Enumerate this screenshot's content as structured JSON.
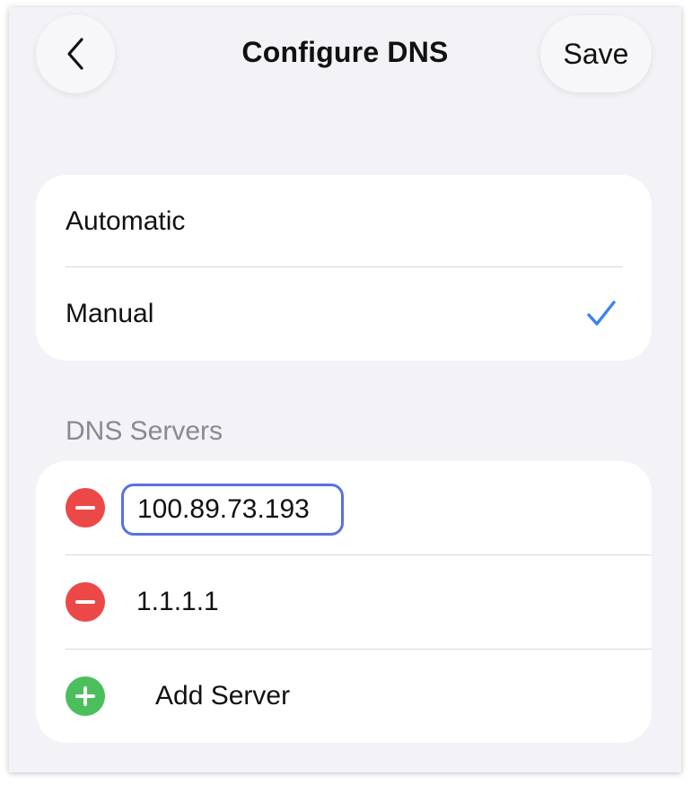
{
  "header": {
    "title": "Configure DNS",
    "back_icon": "chevron-left-icon",
    "save_label": "Save"
  },
  "mode": {
    "options": [
      {
        "label": "Automatic",
        "selected": false
      },
      {
        "label": "Manual",
        "selected": true
      }
    ],
    "check_icon": "checkmark-icon",
    "accent_color": "#3a82f7"
  },
  "dns": {
    "section_title": "DNS Servers",
    "servers": [
      {
        "value": "100.89.73.193",
        "editing": true
      },
      {
        "value": "1.1.1.1",
        "editing": false
      }
    ],
    "add_label": "Add Server",
    "remove_color": "#ec4848",
    "add_color": "#4bbf5c",
    "focus_color": "#5671e8"
  }
}
